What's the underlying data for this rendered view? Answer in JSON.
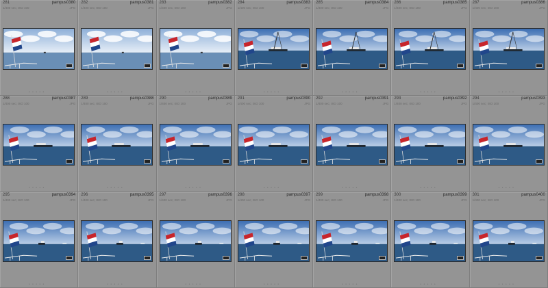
{
  "grid": {
    "rows": 3,
    "cols": 7,
    "cells": [
      {
        "index": "281",
        "filename": "pampus0380",
        "meta": "1/400 sec; ISO 100",
        "ext": "JPG",
        "scene": "flag"
      },
      {
        "index": "282",
        "filename": "pampus0381",
        "meta": "1/400 sec; ISO 100",
        "ext": "JPG",
        "scene": "flag"
      },
      {
        "index": "283",
        "filename": "pampus0382",
        "meta": "1/400 sec; ISO 100",
        "ext": "JPG",
        "scene": "flag"
      },
      {
        "index": "284",
        "filename": "pampus0383",
        "meta": "1/400 sec; ISO 100",
        "ext": "JPG",
        "scene": "crane"
      },
      {
        "index": "285",
        "filename": "pampus0384",
        "meta": "1/400 sec; ISO 100",
        "ext": "JPG",
        "scene": "crane"
      },
      {
        "index": "286",
        "filename": "pampus0385",
        "meta": "1/400 sec; ISO 100",
        "ext": "JPG",
        "scene": "crane"
      },
      {
        "index": "287",
        "filename": "pampus0386",
        "meta": "1/400 sec; ISO 100",
        "ext": "JPG",
        "scene": "crane"
      },
      {
        "index": "288",
        "filename": "pampus0387",
        "meta": "1/400 sec; ISO 100",
        "ext": "JPG",
        "scene": "ship"
      },
      {
        "index": "289",
        "filename": "pampus0388",
        "meta": "1/400 sec; ISO 100",
        "ext": "JPG",
        "scene": "ship"
      },
      {
        "index": "290",
        "filename": "pampus0389",
        "meta": "1/400 sec; ISO 100",
        "ext": "JPG",
        "scene": "ship"
      },
      {
        "index": "291",
        "filename": "pampus0390",
        "meta": "1/400 sec; ISO 100",
        "ext": "JPG",
        "scene": "ship"
      },
      {
        "index": "292",
        "filename": "pampus0391",
        "meta": "1/400 sec; ISO 100",
        "ext": "JPG",
        "scene": "ship"
      },
      {
        "index": "293",
        "filename": "pampus0392",
        "meta": "1/400 sec; ISO 100",
        "ext": "JPG",
        "scene": "ship"
      },
      {
        "index": "294",
        "filename": "pampus0393",
        "meta": "1/400 sec; ISO 100",
        "ext": "JPG",
        "scene": "ship"
      },
      {
        "index": "295",
        "filename": "pampus0394",
        "meta": "1/400 sec; ISO 100",
        "ext": "JPG",
        "scene": "far"
      },
      {
        "index": "296",
        "filename": "pampus0395",
        "meta": "1/400 sec; ISO 100",
        "ext": "JPG",
        "scene": "far"
      },
      {
        "index": "297",
        "filename": "pampus0396",
        "meta": "1/400 sec; ISO 100",
        "ext": "JPG",
        "scene": "far"
      },
      {
        "index": "298",
        "filename": "pampus0397",
        "meta": "1/400 sec; ISO 100",
        "ext": "JPG",
        "scene": "far"
      },
      {
        "index": "299",
        "filename": "pampus0398",
        "meta": "1/400 sec; ISO 100",
        "ext": "JPG",
        "scene": "far"
      },
      {
        "index": "300",
        "filename": "pampus0399",
        "meta": "1/400 sec; ISO 100",
        "ext": "JPG",
        "scene": "far"
      },
      {
        "index": "301",
        "filename": "pampus0400",
        "meta": "1/400 sec; ISO 100",
        "ext": "JPG",
        "scene": "far"
      }
    ]
  },
  "colors": {
    "sky_top": "#3d6fb3",
    "sky_bottom": "#b9cde6",
    "water": "#2e5a86",
    "flag_red": "#c8252b",
    "flag_white": "#ffffff",
    "flag_blue": "#21468b"
  }
}
